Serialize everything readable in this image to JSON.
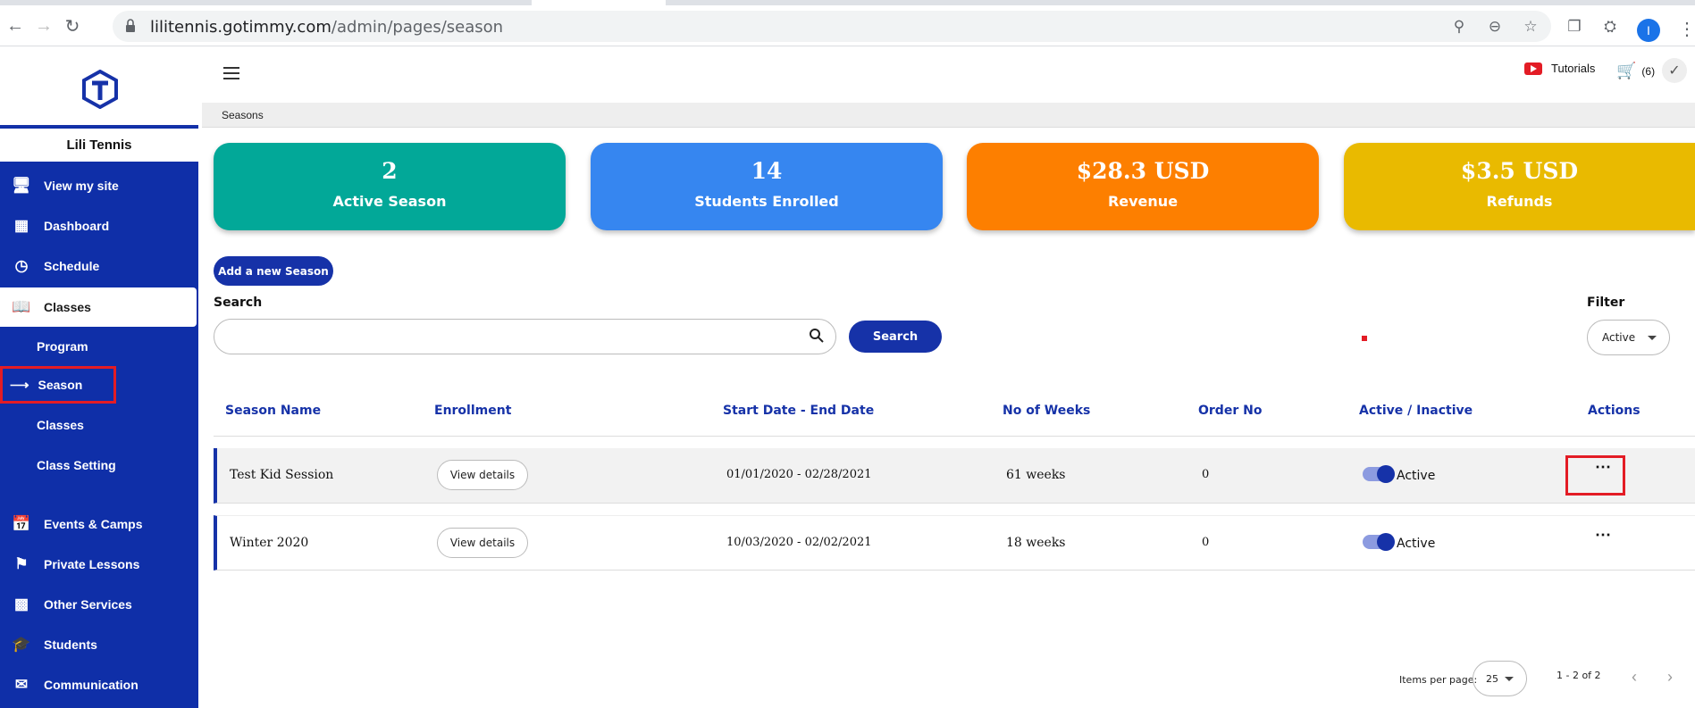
{
  "browser": {
    "url_host": "lilitennis.gotimmy.com",
    "url_path": "/admin/pages/season",
    "profile_initial": "I"
  },
  "sidebar": {
    "brand": "Lili Tennis",
    "items": [
      {
        "label": "View my site",
        "icon": "monitor-icon"
      },
      {
        "label": "Dashboard",
        "icon": "dashboard-icon"
      },
      {
        "label": "Schedule",
        "icon": "clock-icon"
      },
      {
        "label": "Classes",
        "icon": "book-icon"
      }
    ],
    "sub_items": [
      {
        "label": "Program"
      },
      {
        "label": "Season"
      },
      {
        "label": "Classes"
      },
      {
        "label": "Class Setting"
      }
    ],
    "items_bottom": [
      {
        "label": "Events & Camps",
        "icon": "calendar-icon"
      },
      {
        "label": "Private Lessons",
        "icon": "reader-icon"
      },
      {
        "label": "Other Services",
        "icon": "widgets-icon"
      },
      {
        "label": "Students",
        "icon": "graduation-cap-icon"
      },
      {
        "label": "Communication",
        "icon": "message-icon"
      }
    ]
  },
  "topbar": {
    "tutorials": "Tutorials",
    "cart_count": "(6)"
  },
  "breadcrumb": "Seasons",
  "stats": [
    {
      "value": "2",
      "label": "Active Season",
      "color": "#02a898"
    },
    {
      "value": "14",
      "label": "Students Enrolled",
      "color": "#3686f0"
    },
    {
      "value": "$28.3 USD",
      "label": "Revenue",
      "color": "#fd7f00"
    },
    {
      "value": "$3.5 USD",
      "label": "Refunds",
      "color": "#e9ba00"
    }
  ],
  "add_button": "Add a new Season",
  "search": {
    "label": "Search",
    "placeholder": "",
    "button": "Search"
  },
  "filter": {
    "label": "Filter",
    "value": "Active"
  },
  "table": {
    "headers": [
      "Season Name",
      "Enrollment",
      "Start Date - End Date",
      "No of Weeks",
      "Order No",
      "Active / Inactive",
      "Actions"
    ],
    "rows": [
      {
        "name": "Test Kid Session",
        "enrollment": "View details",
        "dates": "01/01/2020 - 02/28/2021",
        "weeks": "61 weeks",
        "order": "0",
        "status": "Active"
      },
      {
        "name": "Winter 2020",
        "enrollment": "View details",
        "dates": "10/03/2020 - 02/02/2021",
        "weeks": "18 weeks",
        "order": "0",
        "status": "Active"
      }
    ]
  },
  "pager": {
    "items_label": "Items per page:",
    "per_page": "25",
    "range": "1 - 2 of 2"
  },
  "colors": {
    "sidebar": "#0f2fa8",
    "primary": "#1632a8",
    "highlight": "#e31c25"
  }
}
